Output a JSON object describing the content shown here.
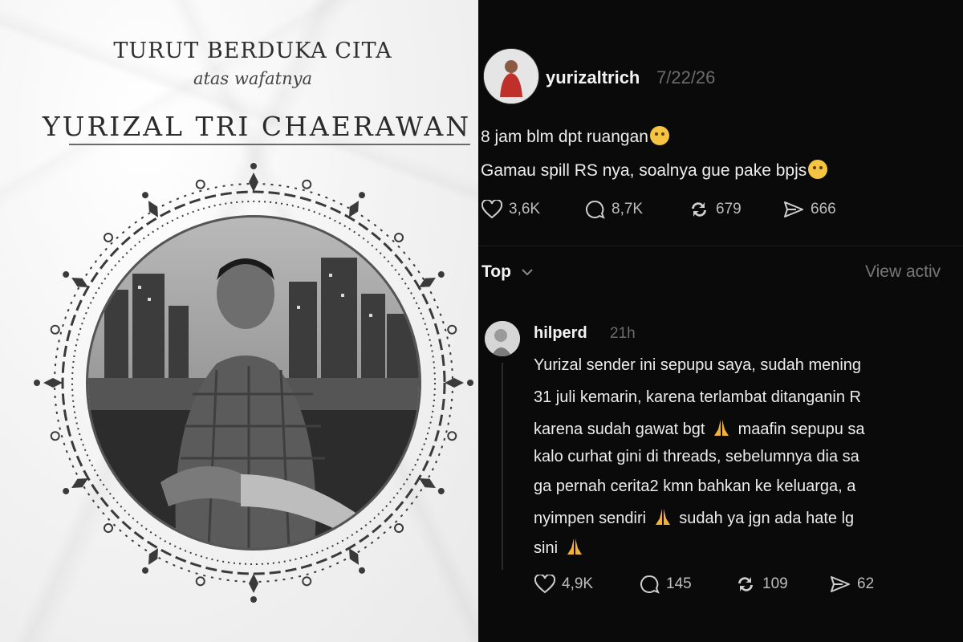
{
  "card": {
    "heading": "TURUT BERDUKA CITA",
    "subheading": "atas wafatnya",
    "name": "YURIZAL TRI CHAERAWAN"
  },
  "post": {
    "username": "yurizaltrich",
    "date": "7/22/26",
    "lines": [
      "8 jam blm dpt ruangan",
      "Gamau spill RS nya, soalnya gue pake bpjs"
    ],
    "stats": {
      "likes": "3,6K",
      "comments": "8,7K",
      "reposts": "679",
      "shares": "666"
    }
  },
  "sort": {
    "label": "Top",
    "view_activity": "View activ"
  },
  "reply": {
    "username": "hilperd",
    "time": "21h",
    "lines": [
      "Yurizal sender ini sepupu saya, sudah mening",
      "31 juli kemarin, karena terlambat ditanganin R",
      "karena sudah gawat bgt",
      "maafin sepupu sa",
      "kalo curhat gini di threads, sebelumnya dia sa",
      "ga pernah cerita2 kmn bahkan ke keluarga, a",
      "nyimpen sendiri",
      "sudah ya jgn ada hate lg",
      "sini"
    ],
    "stats": {
      "likes": "4,9K",
      "comments": "145",
      "reposts": "109",
      "shares": "62"
    }
  },
  "icons": {
    "heart": "heart-icon",
    "comment": "comment-icon",
    "repost": "repost-icon",
    "share": "share-icon",
    "chevron": "chevron-down-icon",
    "pray": "praying-hands-emoji"
  },
  "colors": {
    "thread_bg": "#0a0a0a",
    "card_bg": "#f2f2f2",
    "muted": "#6c6c6c"
  }
}
